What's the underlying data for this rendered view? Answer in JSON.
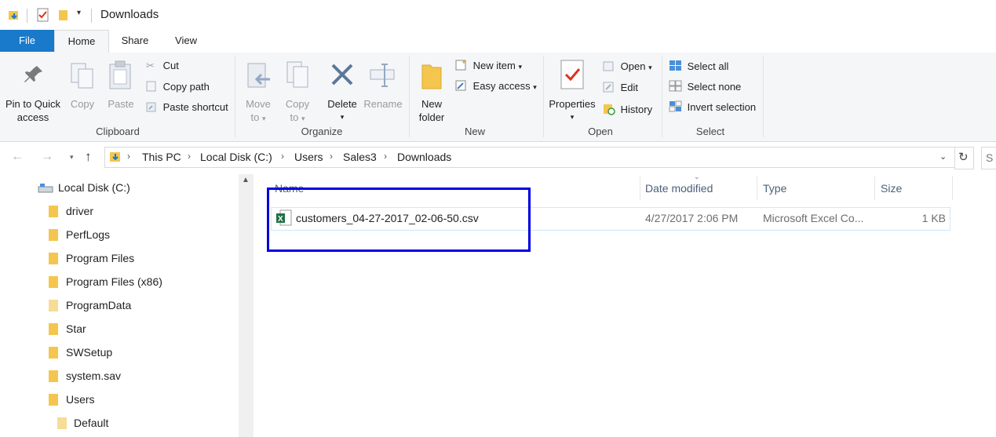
{
  "window": {
    "title": "Downloads"
  },
  "ribbon": {
    "tabs": [
      "File",
      "Home",
      "Share",
      "View"
    ],
    "clipboard": {
      "label": "Clipboard",
      "pin": "Pin to Quick access",
      "pin_line1": "Pin to Quick",
      "pin_line2": "access",
      "copy": "Copy",
      "paste": "Paste",
      "cut": "Cut",
      "copy_path": "Copy path",
      "paste_shortcut": "Paste shortcut"
    },
    "organize": {
      "label": "Organize",
      "move_to_1": "Move",
      "move_to_2": "to",
      "copy_to_1": "Copy",
      "copy_to_2": "to",
      "delete": "Delete",
      "rename": "Rename"
    },
    "new": {
      "label": "New",
      "new_folder_1": "New",
      "new_folder_2": "folder",
      "new_item": "New item",
      "easy_access": "Easy access"
    },
    "open": {
      "label": "Open",
      "properties": "Properties",
      "open": "Open",
      "edit": "Edit",
      "history": "History"
    },
    "select": {
      "label": "Select",
      "select_all": "Select all",
      "select_none": "Select none",
      "invert_selection": "Invert selection"
    }
  },
  "address": {
    "breadcrumbs": [
      "This PC",
      "Local Disk (C:)",
      "Users",
      "Sales3",
      "Downloads"
    ]
  },
  "search": {
    "placeholder": "S"
  },
  "nav": {
    "root": "Local Disk (C:)",
    "items": [
      "driver",
      "PerfLogs",
      "Program Files",
      "Program Files (x86)",
      "ProgramData",
      "Star",
      "SWSetup",
      "system.sav",
      "Users"
    ],
    "subitem": "Default"
  },
  "columns": {
    "name": "Name",
    "date": "Date modified",
    "type": "Type",
    "size": "Size"
  },
  "files": [
    {
      "name": "customers_04-27-2017_02-06-50.csv",
      "date": "4/27/2017 2:06 PM",
      "type": "Microsoft Excel Co...",
      "size": "1 KB"
    }
  ],
  "colors": {
    "accent": "#1979ca",
    "highlight_box": "#0000e0",
    "folder": "#f4c64e"
  }
}
